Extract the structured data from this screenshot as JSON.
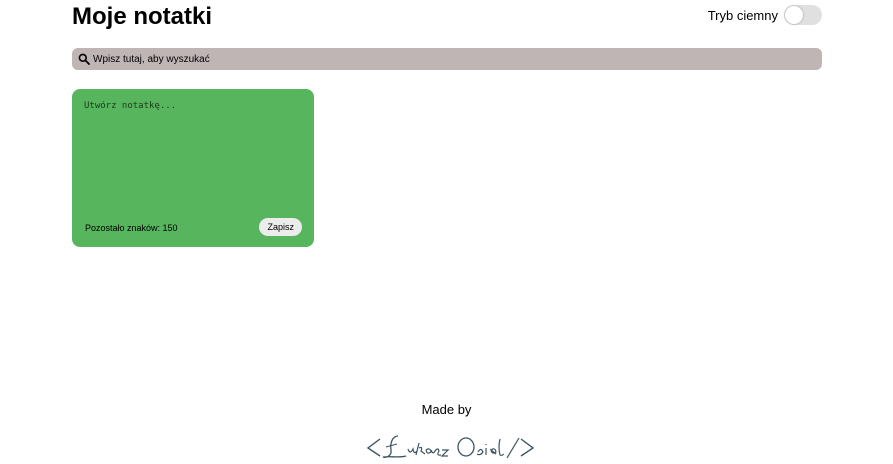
{
  "header": {
    "title": "Moje notatki",
    "dark_mode_label": "Tryb ciemny",
    "dark_mode_on": false
  },
  "search": {
    "placeholder": "Wpisz tutaj, aby wyszukać",
    "icon": "search-icon"
  },
  "new_note": {
    "placeholder": "Utwórz notatkę...",
    "remaining_label": "Pozostało znaków: 150",
    "save_label": "Zapisz",
    "background_color": "#57b55d"
  },
  "footer": {
    "made_by": "Made by",
    "signature": "<Łukasz Osial/>"
  },
  "colors": {
    "search_bar": "#bfb5b5",
    "toggle_track": "#e0e0e0",
    "signature": "#3d5561"
  }
}
